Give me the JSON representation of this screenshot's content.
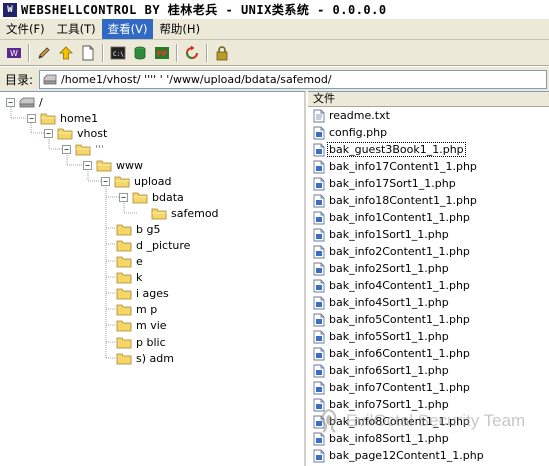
{
  "window": {
    "title": "WEBSHELLCONTROL BY 桂林老兵 - UNIX类系统 -  0.0.0.0"
  },
  "menu": [
    {
      "label": "文件(F)",
      "active": false
    },
    {
      "label": "工具(T)",
      "active": false
    },
    {
      "label": "查看(V)",
      "active": true
    },
    {
      "label": "帮助(H)",
      "active": false
    }
  ],
  "toolbar": [
    {
      "icon": "logo-icon",
      "name": "tb-logo"
    },
    {
      "icon": "pencil-icon",
      "name": "tb-edit"
    },
    {
      "icon": "up-arrow-icon",
      "name": "tb-up"
    },
    {
      "icon": "new-file-icon",
      "name": "tb-new-file"
    },
    {
      "icon": "terminal-icon",
      "name": "tb-cmd"
    },
    {
      "icon": "database-icon",
      "name": "tb-db"
    },
    {
      "icon": "ftp-icon",
      "name": "tb-ftp"
    },
    {
      "icon": "refresh-icon",
      "name": "tb-refresh"
    },
    {
      "icon": "lock-icon",
      "name": "tb-lock"
    }
  ],
  "address": {
    "label": "目录:",
    "path": "/home1/vhost/  '''' ' '/www/upload/bdata/safemod/"
  },
  "tree": {
    "root": "/",
    "nodes": [
      "home1",
      "vhost",
      "'''",
      "www",
      "upload",
      "bdata",
      "safemod",
      "b g5",
      "d _picture",
      "e",
      "k",
      "i ages",
      "m p",
      "m vie",
      "p blic",
      "s) adm"
    ]
  },
  "files": {
    "header": "文件",
    "items": [
      "readme.txt",
      "config.php",
      "bak_guest3Book1_1.php",
      "bak_info17Content1_1.php",
      "bak_info17Sort1_1.php",
      "bak_info18Content1_1.php",
      "bak_info1Content1_1.php",
      "bak_info1Sort1_1.php",
      "bak_info2Content1_1.php",
      "bak_info2Sort1_1.php",
      "bak_info4Content1_1.php",
      "bak_info4Sort1_1.php",
      "bak_info5Content1_1.php",
      "bak_info5Sort1_1.php",
      "bak_info6Content1_1.php",
      "bak_info6Sort1_1.php",
      "bak_info7Content1_1.php",
      "bak_info7Sort1_1.php",
      "bak_info8Content1_1.php",
      "bak_info8Sort1_1.php",
      "bak_page12Content1_1.php"
    ],
    "focused": "bak_guest3Book1_1.php"
  },
  "watermark": "EvilOctal Security Team",
  "colors": {
    "menu_active": "#316ac5",
    "chrome": "#ece9d8",
    "folder": "#f5d66b"
  }
}
